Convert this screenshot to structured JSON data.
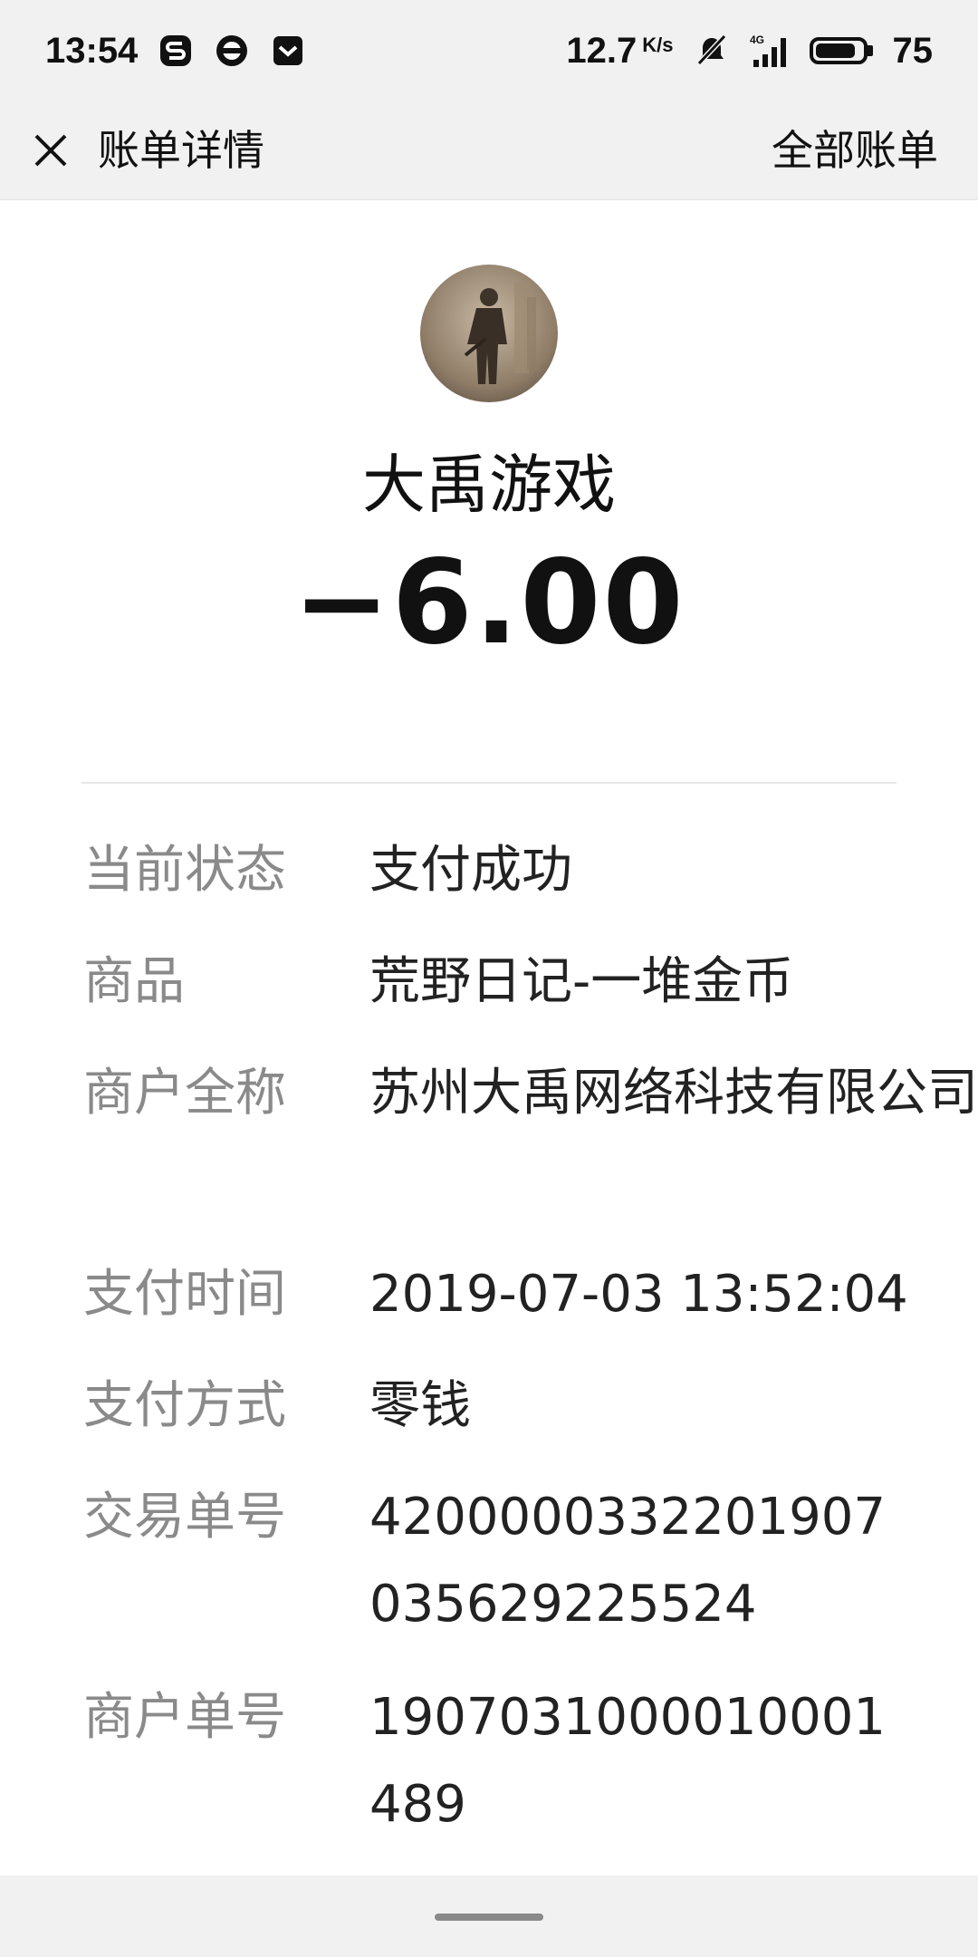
{
  "status_bar": {
    "time": "13:54",
    "net_speed": "12.7",
    "net_speed_unit": "K/s",
    "network_type": "4G",
    "battery_level": "75"
  },
  "header": {
    "title": "账单详情",
    "right_link": "全部账单"
  },
  "bill": {
    "merchant_name": "大禹游戏",
    "amount": "−6.00",
    "details": [
      {
        "label": "当前状态",
        "value": "支付成功"
      },
      {
        "label": "商品",
        "value": "荒野日记-一堆金币"
      },
      {
        "label": "商户全称",
        "value": "苏州大禹网络科技有限公司"
      },
      {
        "label": "支付时间",
        "value": "2019-07-03 13:52:04"
      },
      {
        "label": "支付方式",
        "value": "零钱"
      },
      {
        "label": "交易单号",
        "value": "4200000332201907035629225524"
      },
      {
        "label": "商户单号",
        "value": "1907031000010001489"
      }
    ]
  },
  "colors": {
    "header_bg": "#f1f1f1",
    "label_gray": "#8a8a8a",
    "text_dark": "#111111"
  }
}
